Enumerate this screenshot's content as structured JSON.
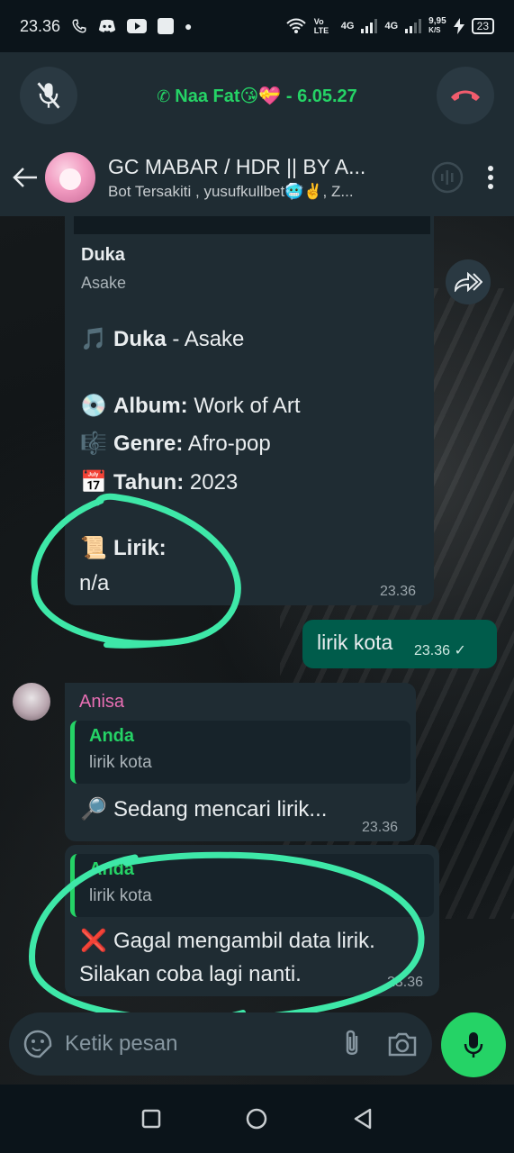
{
  "status_bar": {
    "time": "23.36",
    "net_label_1": "4G",
    "net_label_2": "4G",
    "speed": "9,95",
    "speed_unit": "K/S",
    "battery": "23",
    "volte": "Vo LTE"
  },
  "call_bar": {
    "title": "Naa Fat😘💝 - 6.05.27"
  },
  "header": {
    "group_name": "GC MABAR / HDR || BY A...",
    "participants": "Bot Tersakiti , yusufkullbet🥶✌️, Z..."
  },
  "messages": {
    "song": {
      "preview_title": "Duka",
      "preview_artist": "Asake",
      "line_song_emoji": "🎵",
      "line_song_title": "Duka",
      "line_song_rest": " - Asake",
      "album_emoji": "💿",
      "album_label": "Album:",
      "album_value": " Work of Art",
      "genre_emoji": "🎼",
      "genre_label": "Genre:",
      "genre_value": " Afro-pop",
      "year_emoji": "📅",
      "year_label": "Tahun:",
      "year_value": " 2023",
      "lyric_emoji": "📜",
      "lyric_label": "Lirik:",
      "lyric_value": "n/a",
      "time": "23.36"
    },
    "outgoing": {
      "text": "lirik kota",
      "time": "23.36",
      "status": "✓"
    },
    "reply1": {
      "sender": "Anisa",
      "quote_name": "Anda",
      "quote_text": "lirik kota",
      "emoji": "🔎",
      "text": "Sedang mencari lirik...",
      "time": "23.36"
    },
    "reply2": {
      "quote_name": "Anda",
      "quote_text": "lirik kota",
      "emoji": "❌",
      "text_line1": "Gagal mengambil data lirik.",
      "text_line2": "Silakan coba lagi nanti.",
      "time": "23.36"
    }
  },
  "composer": {
    "placeholder": "Ketik pesan"
  },
  "colors": {
    "accent_green": "#25d366",
    "annotation": "#3ee8a8",
    "bubble_in": "#1f2c33",
    "bubble_out": "#005c4b",
    "hangup": "#f15c6d",
    "sender_pink": "#e86fb4"
  }
}
